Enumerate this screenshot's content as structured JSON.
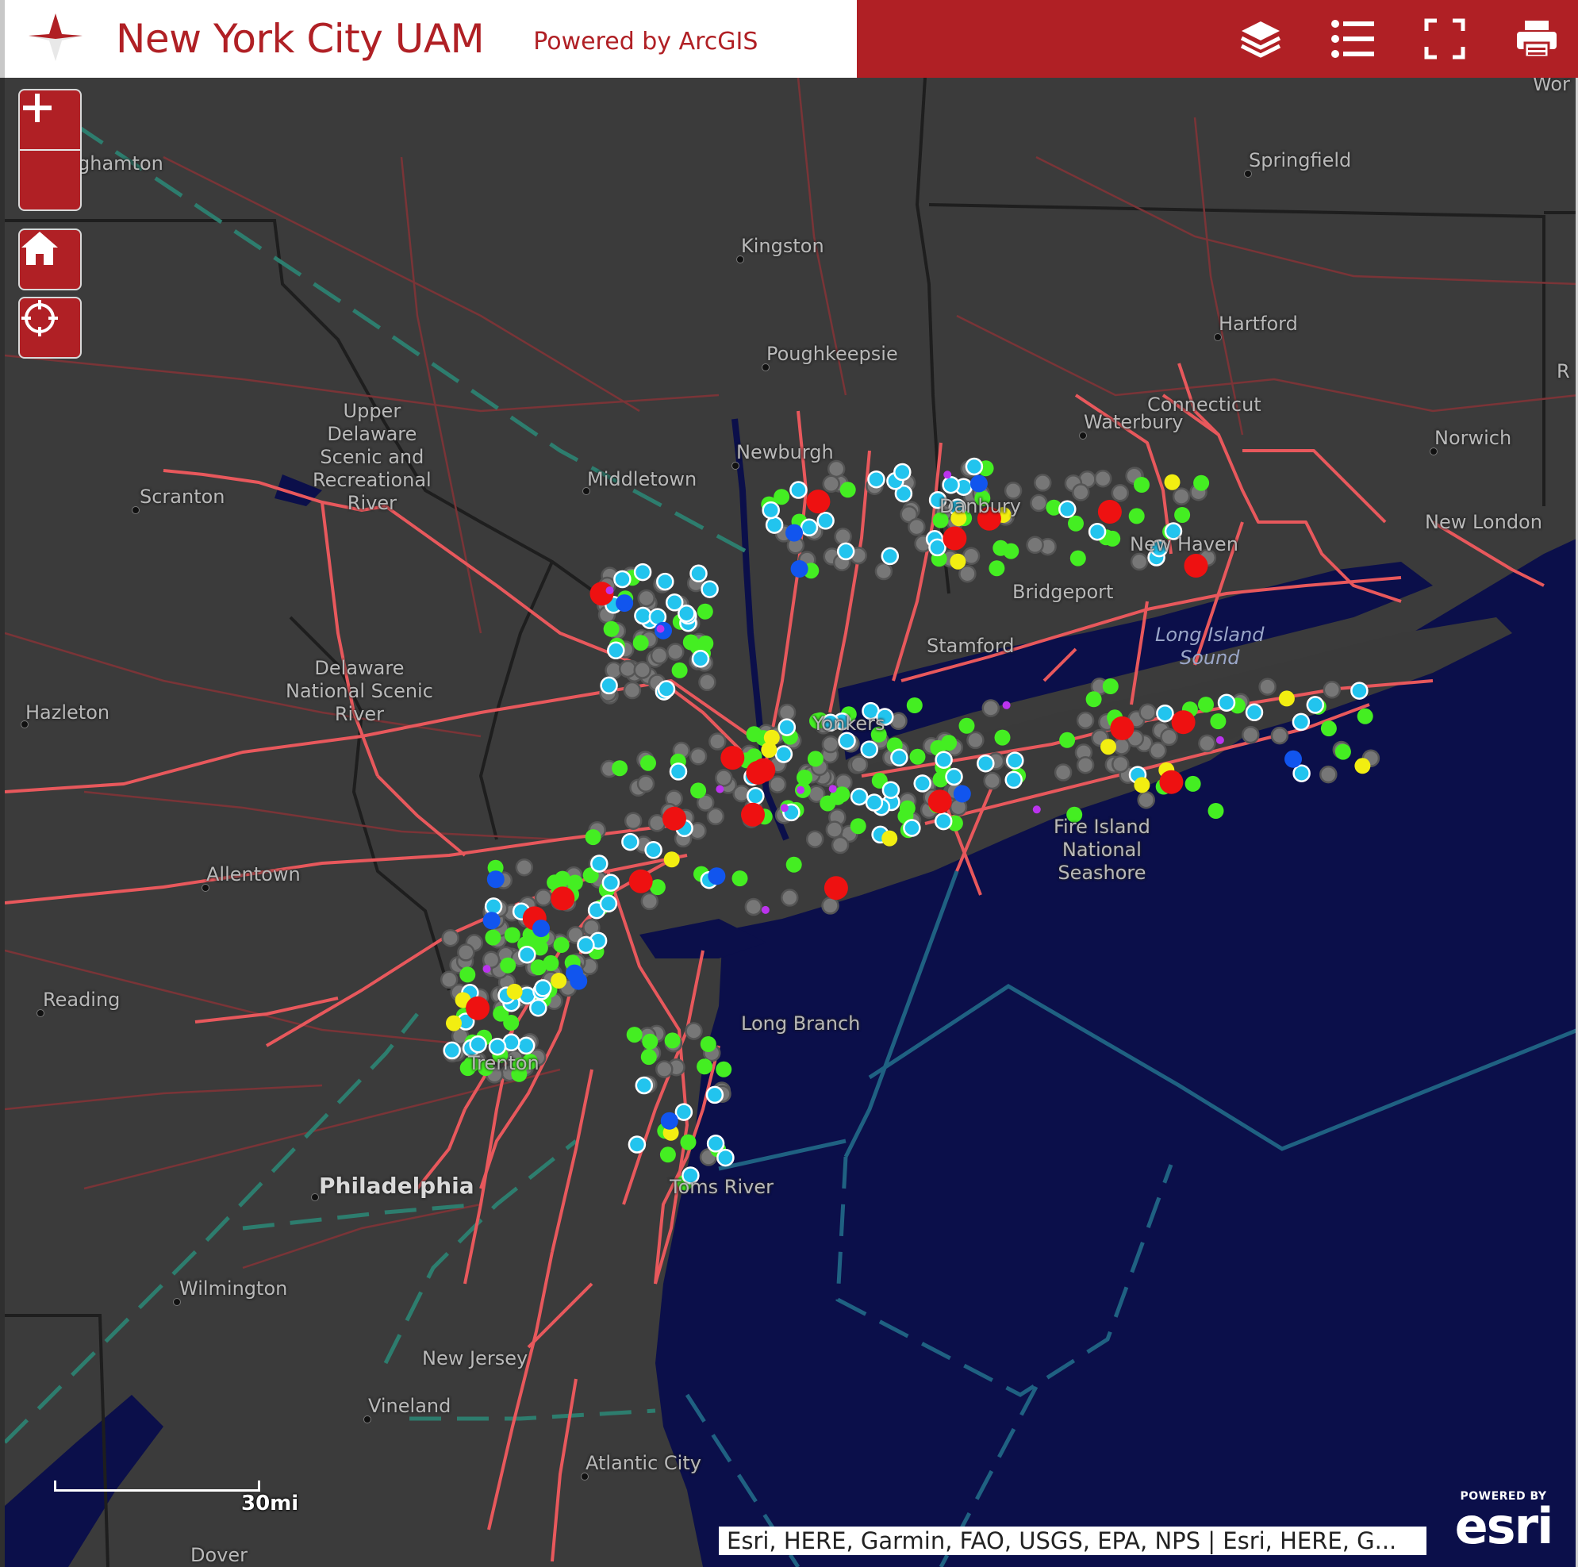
{
  "header": {
    "title": "New York City UAM",
    "subtitle": "Powered by ArcGIS",
    "buttons": [
      {
        "name": "layers",
        "icon": "layers-icon"
      },
      {
        "name": "legend",
        "icon": "list-icon"
      },
      {
        "name": "fullscreen",
        "icon": "fullscreen-icon"
      },
      {
        "name": "print",
        "icon": "print-icon"
      }
    ]
  },
  "controls": {
    "zoom_in": "+",
    "zoom_out": "−",
    "home_icon": "home-icon",
    "locate_icon": "locate-icon"
  },
  "places": {
    "binghamton": "ghamton",
    "springfield": "Springfield",
    "kingston": "Kingston",
    "hartford": "Hartford",
    "poughkeepsie": "Poughkeepsie",
    "waterbury": "Waterbury",
    "connecticut": "Connecticut",
    "norwich": "Norwich",
    "upper_delaware": [
      "Upper",
      "Delaware",
      "Scenic and",
      "Recreational",
      "River"
    ],
    "newburgh": "Newburgh",
    "middletown": "Middletown",
    "scranton": "Scranton",
    "danbury": "Danbury",
    "new_london": "New London",
    "new_haven": "New Haven",
    "bridgeport": "Bridgeport",
    "stamford": "Stamford",
    "delaware_water_gap": [
      "Delaware",
      "National Scenic",
      "River"
    ],
    "hazleton": "Hazleton",
    "yonkers": "Yonkers",
    "fire_island": [
      "Fire Island",
      "National",
      "Seashore"
    ],
    "allentown": "Allentown",
    "reading": "Reading",
    "long_branch": "Long Branch",
    "trenton": "Trenton",
    "philadelphia": "Philadelphia",
    "toms_river": "Toms River",
    "wilmington": "Wilmington",
    "new_jersey": "New Jersey",
    "vineland": "Vineland",
    "atlantic_city": "Atlantic City",
    "dover": "Dover",
    "worcester_partial": "Wor",
    "ri_partial": "R"
  },
  "water_labels": {
    "long_island_sound": [
      "Long Island",
      "Sound"
    ]
  },
  "scale": {
    "label": "30mi"
  },
  "attribution": "Esri, HERE, Garmin, FAO, USGS, EPA, NPS | Esri, HERE, G...",
  "esri_logo": {
    "powered": "POWERED BY",
    "word": "esri"
  },
  "colors": {
    "header_red": "#b02025",
    "map_land": "#3b3b3b",
    "map_water": "#0b0f4a",
    "rail_line": "#e8585c",
    "road_line": "#7a3437",
    "gray_site": "#777777",
    "green_site": "#44ee22",
    "cyan_site": "#22c4ee",
    "red_site": "#ee1111",
    "yellow_site": "#f2ee11",
    "blue_site": "#1155ee",
    "purple_site": "#bb33ee"
  }
}
